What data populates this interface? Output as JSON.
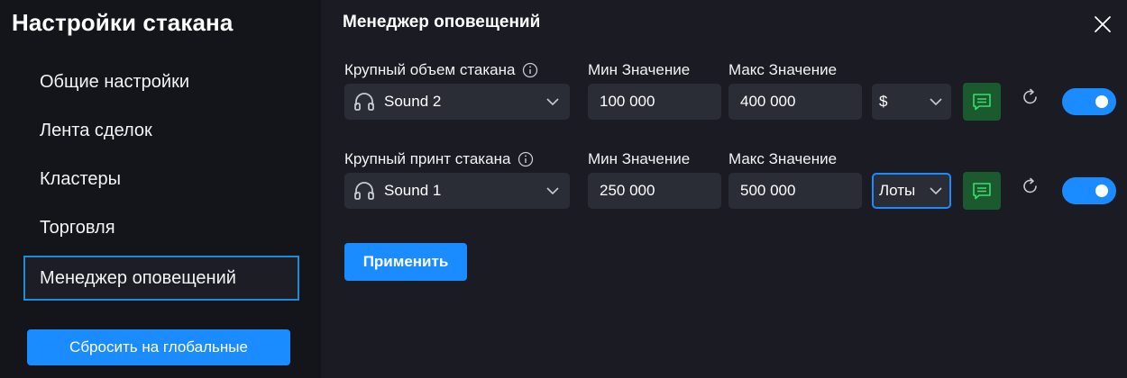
{
  "sidebar": {
    "title": "Настройки стакана",
    "items": [
      {
        "label": "Общие настройки"
      },
      {
        "label": "Лента сделок"
      },
      {
        "label": "Кластеры"
      },
      {
        "label": "Торговля"
      },
      {
        "label": "Менеджер оповещений",
        "active": true
      }
    ],
    "reset_label": "Сбросить на глобальные"
  },
  "main": {
    "title": "Менеджер оповещений",
    "rows": [
      {
        "label": "Крупный объем стакана",
        "sound": "Sound 2",
        "min_label": "Мин Значение",
        "min_value": "100 000",
        "max_label": "Макс Значение",
        "max_value": "400 000",
        "unit": "$",
        "enabled": true
      },
      {
        "label": "Крупный принт стакана",
        "sound": "Sound 1",
        "min_label": "Мин Значение",
        "min_value": "250 000",
        "max_label": "Макс Значение",
        "max_value": "500 000",
        "unit": "Лоты",
        "enabled": true
      }
    ],
    "apply_label": "Применить"
  },
  "colors": {
    "sidebar_bg": "#14151a",
    "main_bg": "#1b1c23",
    "field_bg": "#2a2c36",
    "accent": "#1a8cff",
    "note_button_bg": "#1b5a2e",
    "note_icon": "#3ddc6e"
  },
  "icons": [
    "close-icon",
    "info-icon",
    "headphones-icon",
    "chevron-down-icon",
    "message-icon",
    "refresh-icon"
  ]
}
